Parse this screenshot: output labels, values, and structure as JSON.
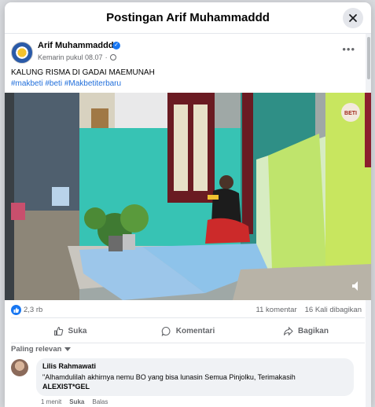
{
  "modal": {
    "title": "Postingan Arif Muhammaddd"
  },
  "post": {
    "author": "Arif Muhammaddd",
    "time": "Kemarin pukul 08.07",
    "caption": "KALUNG RISMA DI GADAI MAEMUNAH",
    "hashtags": "#makbeti #beti #Makbetiterbaru"
  },
  "stats": {
    "likes": "2,3 rb",
    "comments": "11 komentar",
    "shares": "16 Kali dibagikan"
  },
  "actions": {
    "like": "Suka",
    "comment": "Komentari",
    "share": "Bagikan"
  },
  "sort": {
    "label": "Paling relevan"
  },
  "comment": {
    "name": "Lilis Rahmawati",
    "text": "\"Alhamdulilah akhirnya nemu BO yang bisa lunasin Semua Pinjolku, Terimakasih",
    "bold": "ALEXIST*GEL",
    "time": "1 menit",
    "like": "Suka",
    "reply": "Balas"
  },
  "colors": {
    "link": "#216fdb",
    "accent": "#1877f2",
    "wall": "#37c3b4"
  },
  "icons": [
    "close-icon",
    "verified-icon",
    "globe-icon",
    "more-icon",
    "volume-icon",
    "like-icon",
    "comment-icon",
    "share-icon",
    "chevron-down-icon"
  ]
}
